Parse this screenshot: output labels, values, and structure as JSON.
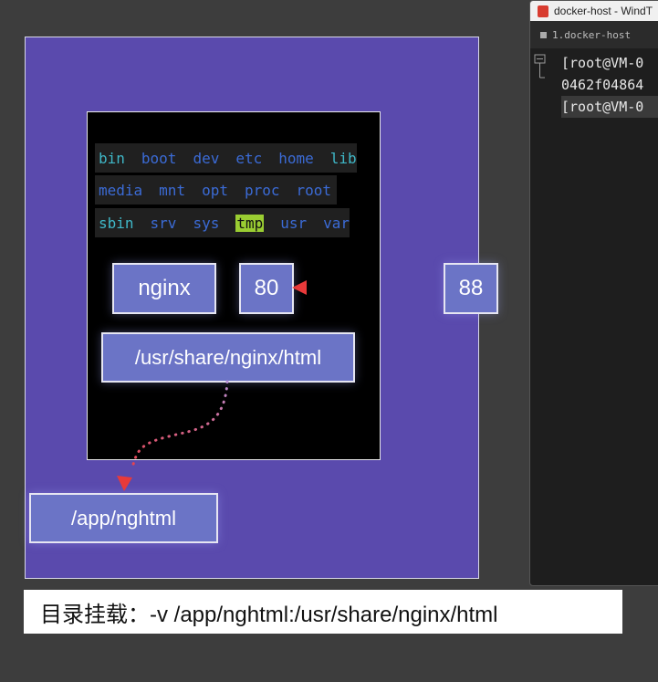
{
  "terminal": {
    "window_title": "docker-host - WindT",
    "tab_label": "1.docker-host",
    "lines": [
      "[root@VM-0",
      "0462f04864",
      "[root@VM-0"
    ]
  },
  "diagram": {
    "fs_rows": [
      [
        "bin",
        "boot",
        "dev",
        "etc",
        "home",
        "lib"
      ],
      [
        "media",
        "mnt",
        "opt",
        "proc",
        "root"
      ],
      [
        "sbin",
        "srv",
        "sys",
        "tmp",
        "usr",
        "var"
      ]
    ],
    "container_app": "nginx",
    "container_port": "80",
    "host_port": "88",
    "container_path": "/usr/share/nginx/html",
    "host_path": "/app/nghtml"
  },
  "caption": "目录挂载：-v /app/nghtml:/usr/share/nginx/html",
  "colors": {
    "host_bg": "#5a4aad",
    "box_fill": "#6b74c6",
    "arrow_head": "#e83a3a",
    "arrow_dots": "#c58ad8"
  }
}
